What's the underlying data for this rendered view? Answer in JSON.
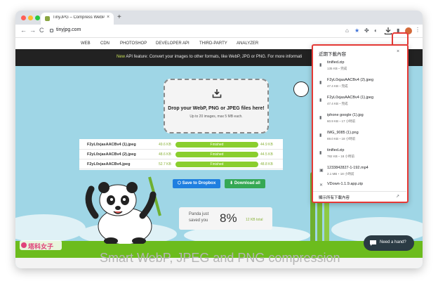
{
  "browser": {
    "tab_title": "TinyJPG – Compress WebP, P",
    "tab_close": "×",
    "new_tab": "+",
    "url": "tinyjpg.com",
    "back": "←",
    "forward": "→",
    "reload": "C",
    "menu": "⋮"
  },
  "site_nav": [
    "WEB",
    "CDN",
    "PHOTOSHOP",
    "DEVELOPER API",
    "THIRD-PARTY",
    "ANALYZER"
  ],
  "banner": {
    "new_label": "New",
    "text": " API feature: Convert your images to other formats, like WebP, JPG or PNG. For more informati"
  },
  "dropzone": {
    "title": "Drop your WebP, PNG or JPEG files here!",
    "subtitle": "Up to 20 images, max 5 MB each."
  },
  "results": [
    {
      "name": "F2yL0xjasAACBv4 (1).jpeg",
      "original": "49.6 KB",
      "status": "Finished",
      "compressed": "44.9 KB"
    },
    {
      "name": "F2yL0xjasAACBv4 (2).jpeg",
      "original": "48.6 KB",
      "status": "Finished",
      "compressed": "44.5 KB"
    },
    {
      "name": "F2yL0xjasAACBv4.jpeg",
      "original": "52.7 KB",
      "status": "Finished",
      "compressed": "48.8 KB"
    }
  ],
  "actions": {
    "dropbox": "Save to Dropbox",
    "download_all": "Download all"
  },
  "stats": {
    "line1": "Panda just",
    "line2": "saved you",
    "percent": "8%",
    "total": "12 KB total"
  },
  "bottom_heading": "Smart WebP, JPEG and PNG compression",
  "brand": "塔科女子",
  "help": "Need a hand?",
  "downloads": {
    "title": "近期下載內容",
    "close": "×",
    "items": [
      {
        "name": "tinified.zip",
        "meta": "135 KB・完成"
      },
      {
        "name": "F2yL0xjasAACBv4 (2).jpeg",
        "meta": "47.4 KB・完成"
      },
      {
        "name": "F2yL0xjasAACBv4 (1).jpeg",
        "meta": "47.4 KB・完成"
      },
      {
        "name": "iphone google (1).jpg",
        "meta": "60.9 KB・17 小時前"
      },
      {
        "name": "IMG_9085 (1).png",
        "meta": "69.0 KB・18 小時前"
      },
      {
        "name": "tinified.zip",
        "meta": "782 KB・18 小時前"
      },
      {
        "name": "1233842827-1-192.mp4",
        "meta": "2.1 MB・18 小時前"
      },
      {
        "name": "VDown-1.1.9.app.zip",
        "meta": ""
      }
    ],
    "show_all": "顯示所有下載內容",
    "open_icon": "↗"
  },
  "colors": {
    "accent_red": "#e53935",
    "progress_green": "#8ace2e",
    "dropbox_blue": "#1f7fe0",
    "download_green": "#35a854"
  }
}
